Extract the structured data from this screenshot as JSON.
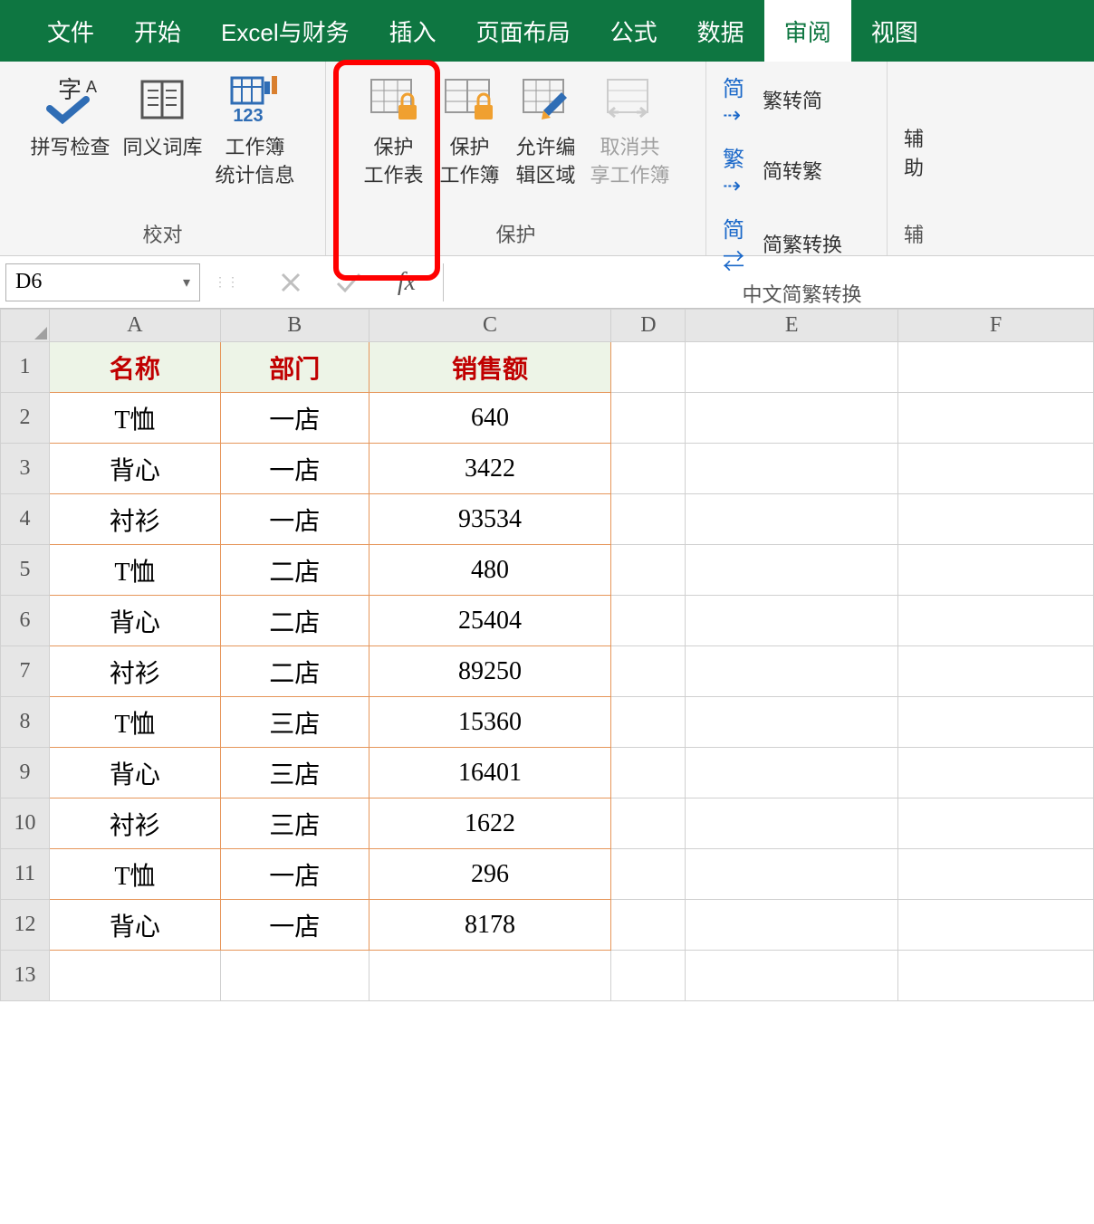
{
  "menu": {
    "items": [
      {
        "label": "文件"
      },
      {
        "label": "开始"
      },
      {
        "label": "Excel与财务"
      },
      {
        "label": "插入"
      },
      {
        "label": "页面布局"
      },
      {
        "label": "公式"
      },
      {
        "label": "数据"
      },
      {
        "label": "审阅",
        "active": true
      },
      {
        "label": "视图"
      }
    ]
  },
  "ribbon": {
    "group_proof": {
      "spellcheck": "拼写检查",
      "thesaurus": "同义词库",
      "stats1": "工作簿",
      "stats2": "统计信息",
      "label": "校对"
    },
    "group_protect": {
      "protect_sheet1": "保护",
      "protect_sheet2": "工作表",
      "protect_wb1": "保护",
      "protect_wb2": "工作簿",
      "allow_edit1": "允许编",
      "allow_edit2": "辑区域",
      "unshare1": "取消共",
      "unshare2": "享工作簿",
      "label": "保护"
    },
    "group_chinese": {
      "to_simp": "繁转简",
      "to_trad": "简转繁",
      "convert": "简繁转换",
      "label": "中文简繁转换"
    },
    "group_aux": {
      "partial1": "辅助",
      "partial2": "辅"
    }
  },
  "namebox": {
    "value": "D6"
  },
  "formula_bar": {
    "cancel": "✕",
    "accept": "✓",
    "fx": "fx",
    "value": ""
  },
  "columns": [
    "A",
    "B",
    "C",
    "D",
    "E",
    "F"
  ],
  "headers": {
    "A": "名称",
    "B": "部门",
    "C": "销售额"
  },
  "rows": [
    {
      "n": "1"
    },
    {
      "n": "2",
      "A": "T恤",
      "B": "一店",
      "C": "640"
    },
    {
      "n": "3",
      "A": "背心",
      "B": "一店",
      "C": "3422"
    },
    {
      "n": "4",
      "A": "衬衫",
      "B": "一店",
      "C": "93534"
    },
    {
      "n": "5",
      "A": "T恤",
      "B": "二店",
      "C": "480"
    },
    {
      "n": "6",
      "A": "背心",
      "B": "二店",
      "C": "25404"
    },
    {
      "n": "7",
      "A": "衬衫",
      "B": "二店",
      "C": "89250"
    },
    {
      "n": "8",
      "A": "T恤",
      "B": "三店",
      "C": "15360"
    },
    {
      "n": "9",
      "A": "背心",
      "B": "三店",
      "C": "16401"
    },
    {
      "n": "10",
      "A": "衬衫",
      "B": "三店",
      "C": "1622"
    },
    {
      "n": "11",
      "A": "T恤",
      "B": "一店",
      "C": "296"
    },
    {
      "n": "12",
      "A": "背心",
      "B": "一店",
      "C": "8178"
    },
    {
      "n": "13"
    }
  ]
}
